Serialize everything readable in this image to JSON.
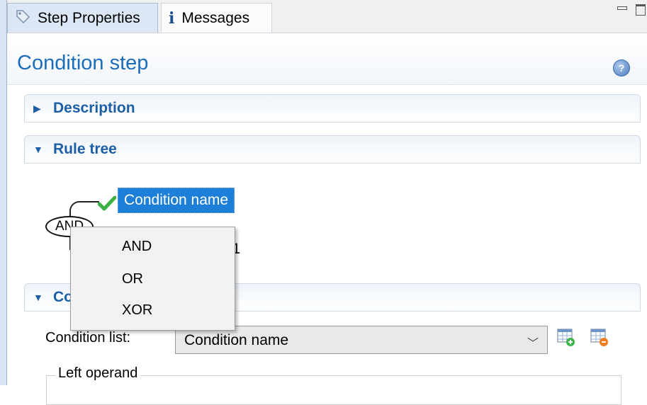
{
  "tabs": [
    {
      "label": "Step Properties",
      "icon": "tag-icon",
      "active": true
    },
    {
      "label": "Messages",
      "icon": "info-icon",
      "active": false
    }
  ],
  "header": {
    "title": "Condition step",
    "help_icon": "help-icon"
  },
  "sections": {
    "description": {
      "label": "Description",
      "expanded": false
    },
    "rule_tree": {
      "label": "Rule tree",
      "expanded": true
    },
    "conditions": {
      "label": "Co",
      "expanded": true
    }
  },
  "rule_tree": {
    "operator": "AND",
    "selected_condition": "Condition name",
    "second_condition_partial": "e1"
  },
  "context_menu": {
    "items": [
      "AND",
      "OR",
      "XOR"
    ]
  },
  "condition_list": {
    "label": "Condition list:",
    "selected": "Condition name",
    "add_icon": "table-add-icon",
    "remove_icon": "table-remove-icon"
  },
  "left_operand": {
    "label": "Left operand"
  },
  "colors": {
    "accent": "#1c6db9",
    "selection": "#1e7fd9",
    "check": "#3cb043"
  }
}
